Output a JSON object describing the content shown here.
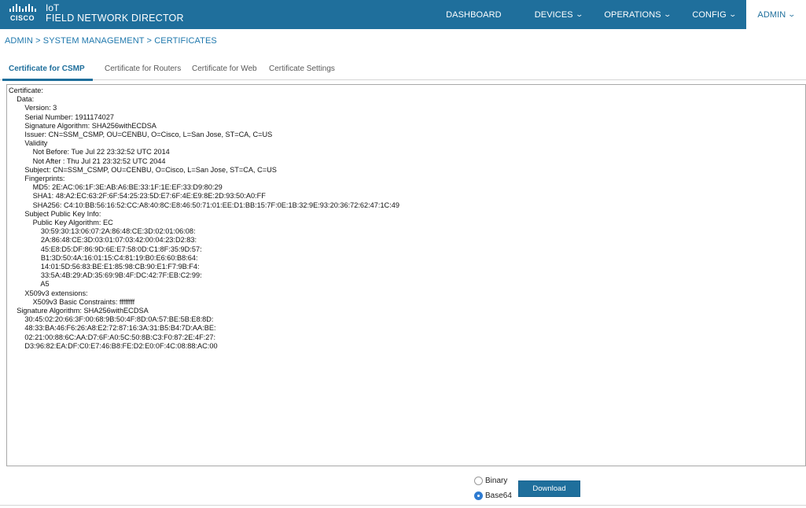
{
  "header": {
    "logo_text": "CISCO",
    "product_line1": "IoT",
    "product_line2": "FIELD NETWORK DIRECTOR",
    "nav": [
      {
        "label": "DASHBOARD",
        "has_menu": false,
        "active": false
      },
      {
        "label": "DEVICES",
        "has_menu": true,
        "active": false
      },
      {
        "label": "OPERATIONS",
        "has_menu": true,
        "active": false
      },
      {
        "label": "CONFIG",
        "has_menu": true,
        "active": false
      },
      {
        "label": "ADMIN",
        "has_menu": true,
        "active": true
      }
    ],
    "colors": {
      "bar": "#1f6f9c",
      "active_text": "#1f6f9c"
    }
  },
  "breadcrumb": "ADMIN > SYSTEM MANAGEMENT > CERTIFICATES",
  "tabs": [
    {
      "label": "Certificate for CSMP",
      "active": true
    },
    {
      "label": "Certificate for Routers",
      "active": false
    },
    {
      "label": "Certificate for Web",
      "active": false
    },
    {
      "label": "Certificate Settings",
      "active": false
    }
  ],
  "certificate_text": "Certificate:\n    Data:\n        Version: 3\n        Serial Number: 1911174027\n        Signature Algorithm: SHA256withECDSA\n        Issuer: CN=SSM_CSMP, OU=CENBU, O=Cisco, L=San Jose, ST=CA, C=US\n        Validity\n            Not Before: Tue Jul 22 23:32:52 UTC 2014\n            Not After : Thu Jul 21 23:32:52 UTC 2044\n        Subject: CN=SSM_CSMP, OU=CENBU, O=Cisco, L=San Jose, ST=CA, C=US\n        Fingerprints:\n            MD5: 2E:AC:06:1F:3E:AB:A6:BE:33:1F:1E:EF:33:D9:80:29\n            SHA1: 48:A2:EC:63:2F:6F:54:25:23:5D:E7:6F:4E:E9:8E:2D:93:50:A0:FF\n            SHA256: C4:10:BB:56:16:52:CC:A8:40:8C:E8:46:50:71:01:EE:D1:BB:15:7F:0E:1B:32:9E:93:20:36:72:62:47:1C:49\n        Subject Public Key Info:\n            Public Key Algorithm: EC\n                30:59:30:13:06:07:2A:86:48:CE:3D:02:01:06:08:\n                2A:86:48:CE:3D:03:01:07:03:42:00:04:23:D2:83:\n                45:E8:D5:DF:86:9D:6E:E7:58:0D:C1:8F:35:9D:57:\n                B1:3D:50:4A:16:01:15:C4:81:19:B0:E6:60:B8:64:\n                14:01:5D:56:83:BE:E1:85:98:CB:90:E1:F7:9B:F4:\n                33:5A:4B:29:AD:35:69:9B:4F:DC:42:7F:EB:C2:99:\n                A5\n        X509v3 extensions:\n            X509v3 Basic Constraints: ffffffff\n    Signature Algorithm: SHA256withECDSA\n        30:45:02:20:66:3F:00:68:9B:50:4F:8D:0A:57:BE:5B:E8:8D:\n        48:33:BA:46:F6:26:A8:E2:72:87:16:3A:31:B5:B4:7D:AA:BE:\n        02:21:00:88:6C:AA:D7:6F:A0:5C:50:8B:C3:F0:87:2E:4F:27:\n        D3:96:82:EA:DF:C0:E7:46:B8:FE:D2:E0:0F:4C:08:88:AC:00",
  "format_options": [
    {
      "label": "Binary",
      "selected": false
    },
    {
      "label": "Base64",
      "selected": true
    }
  ],
  "download_label": "Download"
}
